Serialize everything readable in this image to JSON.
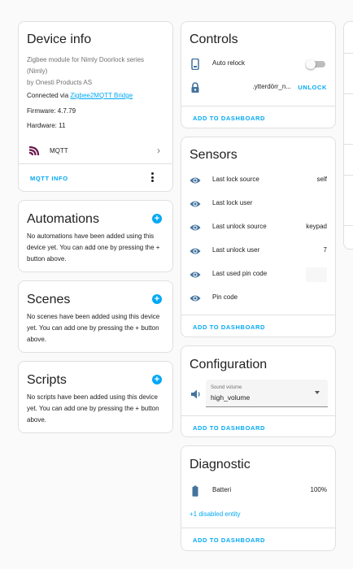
{
  "device_info": {
    "title": "Device info",
    "model_line1": "Zigbee module for Nimly Doorlock series",
    "model_line2": "(Nimly)",
    "manufacturer": "by Onesti Products AS",
    "connected_prefix": "Connected via ",
    "connected_link": "Zigbee2MQTT Bridge",
    "firmware": "Firmware: 4.7.79",
    "hardware": "Hardware: 11",
    "integration": "MQTT",
    "action": "MQTT INFO"
  },
  "automations": {
    "title": "Automations",
    "text": "No automations have been added using this device yet. You can add one by pressing the + button above."
  },
  "scenes": {
    "title": "Scenes",
    "text": "No scenes have been added using this device yet. You can add one by pressing the + button above."
  },
  "scripts": {
    "title": "Scripts",
    "text": "No scripts have been added using this device yet. You can add one by pressing the + button above."
  },
  "controls": {
    "title": "Controls",
    "auto_relock": "Auto relock",
    "lock_name": ".ytterdörr_n...",
    "unlock": "UNLOCK",
    "add": "ADD TO DASHBOARD"
  },
  "sensors": {
    "title": "Sensors",
    "rows": [
      {
        "label": "Last lock source",
        "value": "self"
      },
      {
        "label": "Last lock user",
        "value": ""
      },
      {
        "label": "Last unlock source",
        "value": "keypad"
      },
      {
        "label": "Last unlock user",
        "value": "7"
      },
      {
        "label": "Last used pin code",
        "value": ""
      },
      {
        "label": "Pin code",
        "value": ""
      }
    ],
    "add": "ADD TO DASHBOARD"
  },
  "configuration": {
    "title": "Configuration",
    "select_label": "Sound volume",
    "select_value": "high_volume",
    "add": "ADD TO DASHBOARD"
  },
  "diagnostic": {
    "title": "Diagnostic",
    "entity": "Batteri",
    "value": "100%",
    "disabled": "+1 disabled entity",
    "add": "ADD TO DASHBOARD"
  },
  "colors": {
    "accent": "#03a9f4",
    "icon": "#44739e",
    "mqtt": "#6a1b4d"
  }
}
